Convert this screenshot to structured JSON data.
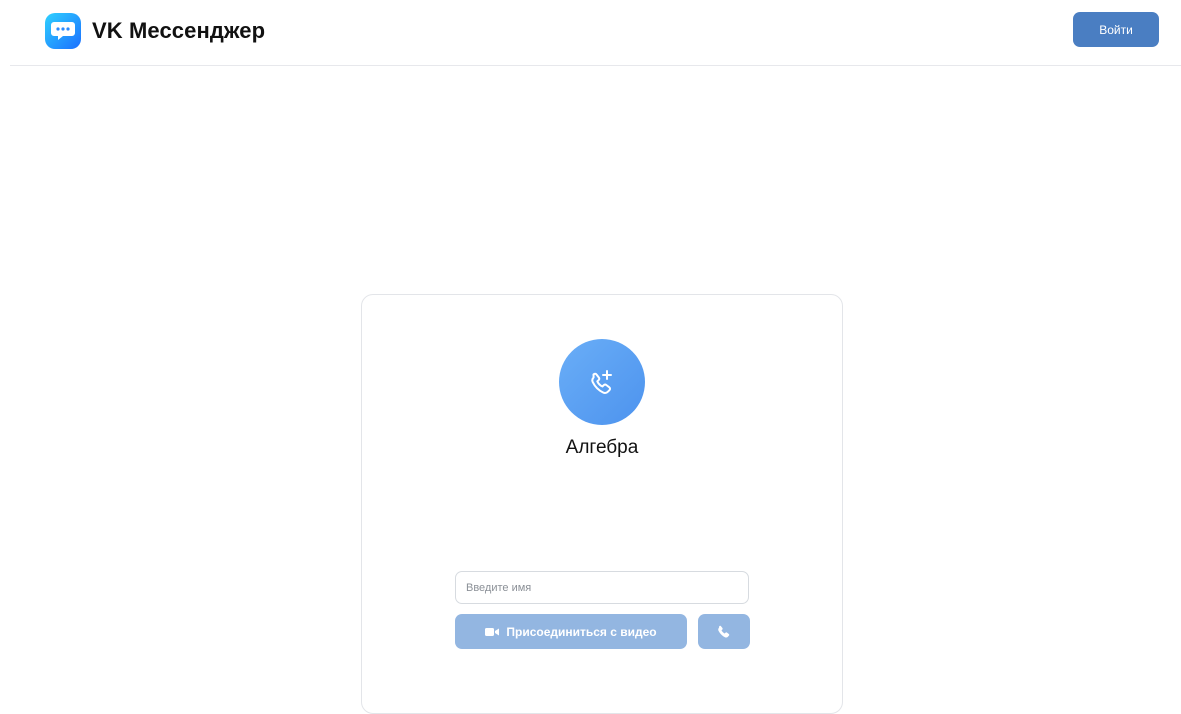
{
  "header": {
    "app_name": "VK Мессенджер",
    "login_label": "Войти",
    "logo_icon": "vk-messenger-logo-icon"
  },
  "call": {
    "title": "Алгебра",
    "avatar_icon": "phone-plus-icon",
    "name_placeholder": "Введите имя",
    "join_video_label": "Присоединиться с видео",
    "join_video_icon": "video-camera-icon",
    "join_audio_icon": "phone-icon"
  },
  "colors": {
    "accent": "#4a7ec2",
    "avatar_gradient_start": "#6aaef7",
    "avatar_gradient_end": "#4d93ee",
    "disabled_button": "#93b6e1"
  }
}
